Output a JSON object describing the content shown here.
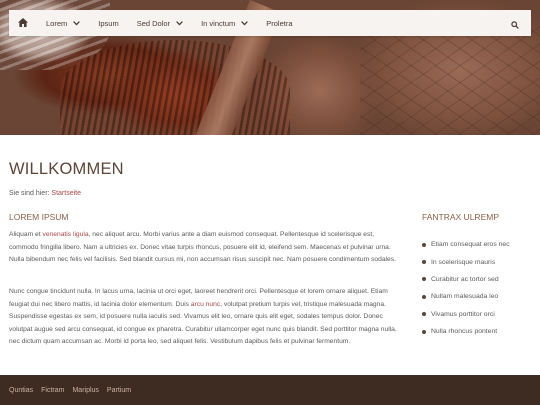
{
  "nav": {
    "items": [
      {
        "label": "Lorem",
        "has_dropdown": true
      },
      {
        "label": "Ipsum",
        "has_dropdown": false
      },
      {
        "label": "Sed Dolor",
        "has_dropdown": true
      },
      {
        "label": "In vinctum",
        "has_dropdown": true
      },
      {
        "label": "Proletra",
        "has_dropdown": false
      }
    ],
    "home_icon": "home-icon",
    "search_icon": "search-icon"
  },
  "page": {
    "title": "WILLKOMMEN",
    "breadcrumb_prefix": "Sie sind hier:",
    "breadcrumb_link": "Startseite"
  },
  "main": {
    "title": "LOREM IPSUM",
    "p1": {
      "t1": "Aliquam et ",
      "link1": "venenatis ligula",
      "t2": ", nec aliquet arcu. Morbi varius ante a diam euismod consequat. Pellentesque id scelerisque est, commodo fringilla libero. Nam a ultricies ex. Donec vitae turpis rhoncus, posuere elit id, eleifend sem. Maecenas et pulvinar urna. Nulla bibendum nec felis vel facilisis. Sed blandit cursus mi, non accumsan risus suscipit nec. Nam posuere condimentum sodales."
    },
    "p2": {
      "t1": "Nunc congue tincidunt nulla. In lacus urna, lacinia ut orci eget, laoreet hendrerit orci. Pellentesque et lorem ornare aliquet. Etiam feugiat dui nec libero mattis, id lacinia dolor elementum. Duis ",
      "link1": "arcu nunc",
      "t2": ", volutpat pretium turpis vel, tristique malesuada magna. Suspendisse egestas ex sem, id posuere nulla iaculis sed. Vivamus elit leo, ornare quis elit eget, sodales tempus dolor. Donec volutpat augue sed arcu consequat, id congue ex pharetra. Curabitur ullamcorper eget nunc quis blandit. Sed porttitor magna nulla, nec dictum quam accumsan ac. Morbi id porta leo, sed aliquet felis. Vestibulum dapibus felis et pulvinar fermentum."
    }
  },
  "sidebar": {
    "title": "FANTRAX ULREMP",
    "items": [
      "Etiam consequat eros nec",
      "In scelerisque mauris",
      "Curabitur ac tortor sed",
      "Nullam malesuada leo",
      "Vivamus porttitor orci",
      "Nulla rhoncus pontent"
    ]
  },
  "footer": {
    "links": [
      "Quntias",
      "Fictram",
      "Mariplus",
      "Partium"
    ]
  },
  "colors": {
    "accent": "#a84848",
    "heading": "#5b4438",
    "section_title": "#8a5f48",
    "footer_bg": "#3e2b22",
    "nav_bg": "#f6f3f1"
  }
}
